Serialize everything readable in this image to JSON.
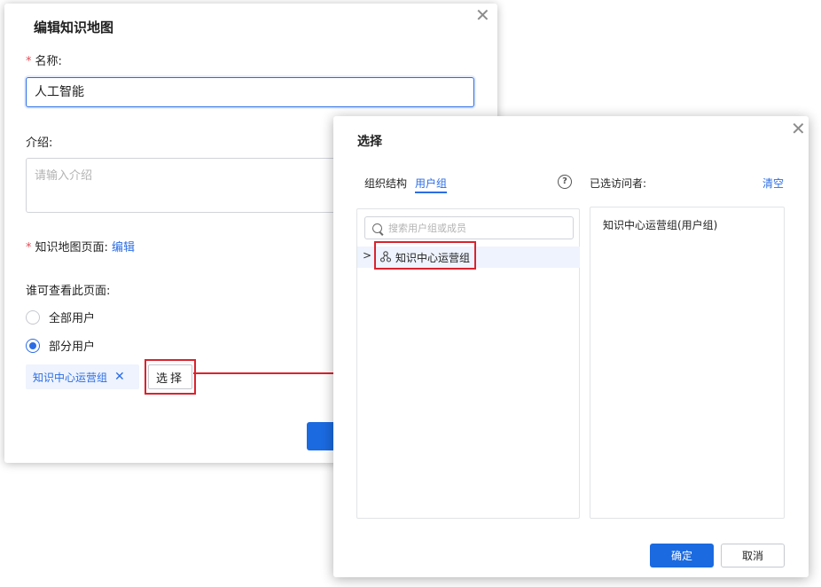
{
  "edit_dialog": {
    "title": "编辑知识地图",
    "close_glyph": "✕",
    "name_label": "名称:",
    "name_value": "人工智能",
    "intro_label": "介绍:",
    "intro_placeholder": "请输入介绍",
    "page_label": "知识地图页面:",
    "page_edit_link": "编辑",
    "visibility_label": "谁可查看此页面:",
    "radio_all": "全部用户",
    "radio_partial": "部分用户",
    "selected_radio": "部分用户",
    "tag_label": "知识中心运营组",
    "tag_remove_glyph": "✕",
    "select_button": "选择",
    "required_mark": "*"
  },
  "select_dialog": {
    "title": "选择",
    "close_glyph": "✕",
    "tabs": [
      "组织结构",
      "用户组"
    ],
    "active_tab": "用户组",
    "help_glyph": "?",
    "selected_label": "已选访问者:",
    "clear_label": "清空",
    "search_placeholder": "搜索用户组或成员",
    "tree": [
      {
        "label": "知识中心运营组",
        "expand_glyph": ">"
      }
    ],
    "selected_items": [
      "知识中心运营组(用户组)"
    ],
    "confirm_button": "确定",
    "cancel_button": "取消"
  },
  "colors": {
    "accent": "#2b6de5",
    "primary_button": "#1b6ae0",
    "annotation_red": "#d9232e"
  },
  "icons": [
    "close-icon",
    "search-icon",
    "user-group-icon",
    "chevron-right-icon",
    "help-icon",
    "remove-tag-icon"
  ]
}
